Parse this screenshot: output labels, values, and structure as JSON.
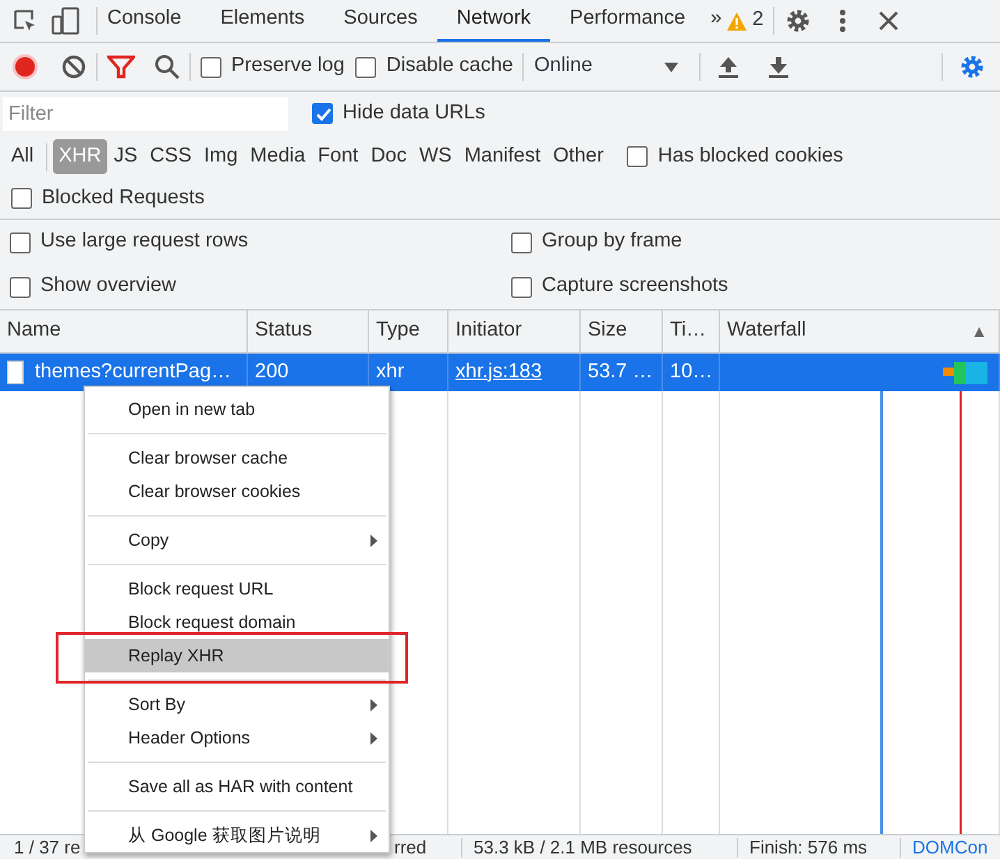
{
  "devtools_tabs": [
    {
      "label": "Console",
      "selected": false
    },
    {
      "label": "Elements",
      "selected": false
    },
    {
      "label": "Sources",
      "selected": false
    },
    {
      "label": "Network",
      "selected": true
    },
    {
      "label": "Performance",
      "selected": false
    }
  ],
  "more_tabs": "»",
  "warning_count": "2",
  "toolbar": {
    "recording": true,
    "preserve_log": {
      "label": "Preserve log",
      "checked": false
    },
    "disable_cache": {
      "label": "Disable cache",
      "checked": false
    },
    "throttling": "Online"
  },
  "filter": {
    "placeholder": "Filter",
    "hide_data_urls": {
      "label": "Hide data URLs",
      "checked": true
    }
  },
  "type_filters": [
    {
      "label": "All",
      "selected": false
    },
    {
      "label": "XHR",
      "selected": true
    },
    {
      "label": "JS",
      "selected": false
    },
    {
      "label": "CSS",
      "selected": false
    },
    {
      "label": "Img",
      "selected": false
    },
    {
      "label": "Media",
      "selected": false
    },
    {
      "label": "Font",
      "selected": false
    },
    {
      "label": "Doc",
      "selected": false
    },
    {
      "label": "WS",
      "selected": false
    },
    {
      "label": "Manifest",
      "selected": false
    },
    {
      "label": "Other",
      "selected": false
    }
  ],
  "has_blocked_cookies": {
    "label": "Has blocked cookies",
    "checked": false
  },
  "blocked_requests": {
    "label": "Blocked Requests",
    "checked": false
  },
  "options": [
    {
      "label": "Use large request rows",
      "checked": false
    },
    {
      "label": "Group by frame",
      "checked": false
    },
    {
      "label": "Show overview",
      "checked": false
    },
    {
      "label": "Capture screenshots",
      "checked": false
    }
  ],
  "table": {
    "columns": [
      "Name",
      "Status",
      "Type",
      "Initiator",
      "Size",
      "Ti…",
      "Waterfall"
    ],
    "sort_indicator": "▲",
    "rows": [
      {
        "selected": true,
        "cells": [
          "themes?currentPag…",
          "200",
          "xhr",
          "xhr.js:183",
          "53.7 …",
          "10…"
        ]
      }
    ]
  },
  "context_menu": {
    "groups": [
      [
        {
          "label": "Open in new tab",
          "submenu": false,
          "selected": false
        }
      ],
      [
        {
          "label": "Clear browser cache",
          "submenu": false,
          "selected": false
        },
        {
          "label": "Clear browser cookies",
          "submenu": false,
          "selected": false
        }
      ],
      [
        {
          "label": "Copy",
          "submenu": true,
          "selected": false
        }
      ],
      [
        {
          "label": "Block request URL",
          "submenu": false,
          "selected": false
        },
        {
          "label": "Block request domain",
          "submenu": false,
          "selected": false
        },
        {
          "label": "Replay XHR",
          "submenu": false,
          "selected": true
        }
      ],
      [
        {
          "label": "Sort By",
          "submenu": true,
          "selected": false
        },
        {
          "label": "Header Options",
          "submenu": true,
          "selected": false
        }
      ],
      [
        {
          "label": "Save all as HAR with content",
          "submenu": false,
          "selected": false
        }
      ],
      [
        {
          "label": "从 Google 获取图片说明",
          "submenu": true,
          "selected": false
        }
      ]
    ]
  },
  "status_bar": [
    {
      "text": "1 / 37 re",
      "kind": "plain"
    },
    {
      "text": "rred",
      "kind": "plain"
    },
    {
      "text": "53.3 kB / 2.1 MB resources",
      "kind": "plain"
    },
    {
      "text": "Finish: 576 ms",
      "kind": "plain"
    },
    {
      "text": "DOMCon",
      "kind": "link"
    }
  ]
}
